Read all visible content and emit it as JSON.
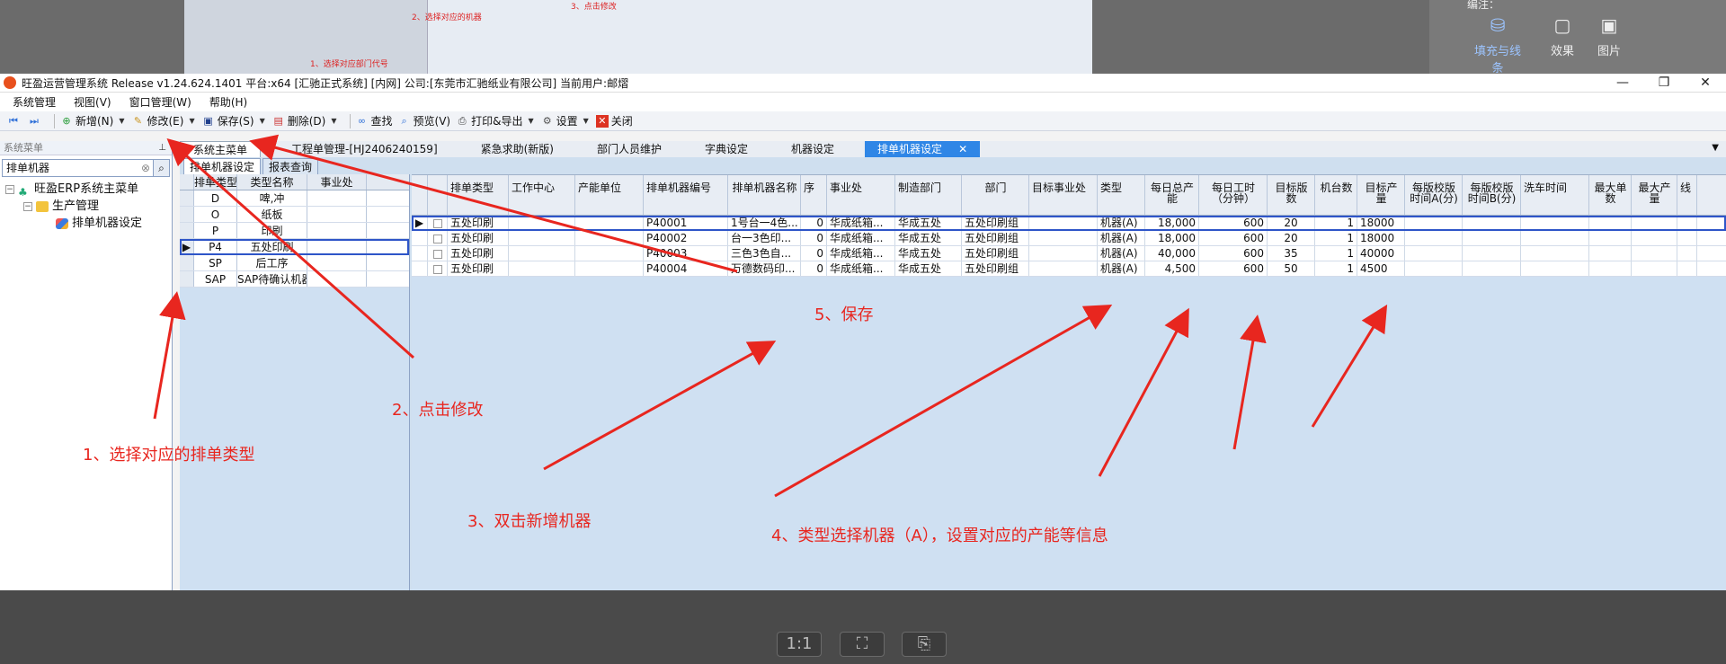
{
  "viewer": {
    "bottom_buttons": [
      "1:1",
      "⛶",
      "⎘"
    ],
    "right_panel_top": "编注：",
    "right_panel_items": [
      {
        "label": "填充与线条",
        "icon": "paint-bucket-icon"
      },
      {
        "label": "效果",
        "icon": "effects-icon"
      },
      {
        "label": "图片",
        "icon": "picture-icon"
      }
    ],
    "bg_labels": [
      "2、选择对应的机器",
      "1、选择对应部门代号",
      "3、点击修改"
    ]
  },
  "app": {
    "title": "旺盈运营管理系统 Release v1.24.624.1401 平台:x64 [汇驰正式系统] [内网] 公司:[东莞市汇驰纸业有限公司] 当前用户:邮熠",
    "window_controls": [
      "—",
      "❐",
      "✕"
    ]
  },
  "menu": [
    "系统管理",
    "视图(V)",
    "窗口管理(W)",
    "帮助(H)"
  ],
  "toolbar": {
    "new": "新增(N)",
    "edit": "修改(E)",
    "save": "保存(S)",
    "delete": "删除(D)",
    "find": "查找",
    "preview": "预览(V)",
    "print": "打印&导出",
    "settings": "设置",
    "close": "关闭"
  },
  "leftpanel": {
    "header": "系统菜单",
    "search_value": "排单机器",
    "tree": {
      "root": "旺盈ERP系统主菜单",
      "group": "生产管理",
      "leaf": "排单机器设定"
    }
  },
  "tabs": [
    {
      "label": "系统主菜单"
    },
    {
      "label": "工程单管理-[HJ2406240159]"
    },
    {
      "label": "紧急求助(新版)"
    },
    {
      "label": "部门人员维护"
    },
    {
      "label": "字典设定"
    },
    {
      "label": "机器设定"
    },
    {
      "label": "排单机器设定"
    }
  ],
  "subtabs": [
    "排单机器设定",
    "报表查询"
  ],
  "typegrid": {
    "headers": [
      "排单类型",
      "类型名称",
      "事业处"
    ],
    "rows": [
      {
        "code": "D",
        "name": "啤,冲",
        "div": ""
      },
      {
        "code": "O",
        "name": "纸板",
        "div": ""
      },
      {
        "code": "P",
        "name": "印刷",
        "div": ""
      },
      {
        "code": "P4",
        "name": "五处印刷",
        "div": ""
      },
      {
        "code": "SP",
        "name": "后工序",
        "div": ""
      },
      {
        "code": "SAP",
        "name": "SAP待确认机器",
        "div": ""
      }
    ]
  },
  "machinegrid": {
    "headers": [
      "排单类型",
      "工作中心",
      "产能单位",
      "排单机器编号",
      "排单机器名称",
      "序",
      "事业处",
      "制造部门",
      "部门",
      "目标事业处",
      "类型",
      "每日总产能",
      "每日工时（分钟）",
      "目标版数",
      "机台数",
      "目标产量",
      "每版校版时间A(分)",
      "每版校版时间B(分)",
      "洗车时间",
      "最大单数",
      "最大产量",
      "线"
    ],
    "rows": [
      {
        "type": "五处印刷",
        "wc": "",
        "unit": "",
        "code": "P40001",
        "name": "1号台一4色...",
        "seq": "0",
        "bu": "华成纸箱...",
        "mfg": "华成五处",
        "dept": "五处印刷组",
        "tbu": "",
        "kind": "机器(A)",
        "cap": "18,000",
        "mins": "600",
        "plates": "20",
        "machines": "1",
        "output": "18000"
      },
      {
        "type": "五处印刷",
        "wc": "",
        "unit": "",
        "code": "P40002",
        "name": "台一3色印...",
        "seq": "0",
        "bu": "华成纸箱...",
        "mfg": "华成五处",
        "dept": "五处印刷组",
        "tbu": "",
        "kind": "机器(A)",
        "cap": "18,000",
        "mins": "600",
        "plates": "20",
        "machines": "1",
        "output": "18000"
      },
      {
        "type": "五处印刷",
        "wc": "",
        "unit": "",
        "code": "P40003",
        "name": "三色3色自...",
        "seq": "0",
        "bu": "华成纸箱...",
        "mfg": "华成五处",
        "dept": "五处印刷组",
        "tbu": "",
        "kind": "机器(A)",
        "cap": "40,000",
        "mins": "600",
        "plates": "35",
        "machines": "1",
        "output": "40000"
      },
      {
        "type": "五处印刷",
        "wc": "",
        "unit": "",
        "code": "P40004",
        "name": "万德数码印...",
        "seq": "0",
        "bu": "华成纸箱...",
        "mfg": "华成五处",
        "dept": "五处印刷组",
        "tbu": "",
        "kind": "机器(A)",
        "cap": "4,500",
        "mins": "600",
        "plates": "50",
        "machines": "1",
        "output": "4500"
      }
    ]
  },
  "annotations": {
    "a1": "1、选择对应的排单类型",
    "a2": "2、点击修改",
    "a3": "3、双击新增机器",
    "a4": "4、类型选择机器（A），设置对应的产能等信息",
    "a5": "5、保存"
  },
  "colors": {
    "annotation": "#e8261f",
    "active_tab": "#2f86e6",
    "selection": "#2e55c8"
  }
}
